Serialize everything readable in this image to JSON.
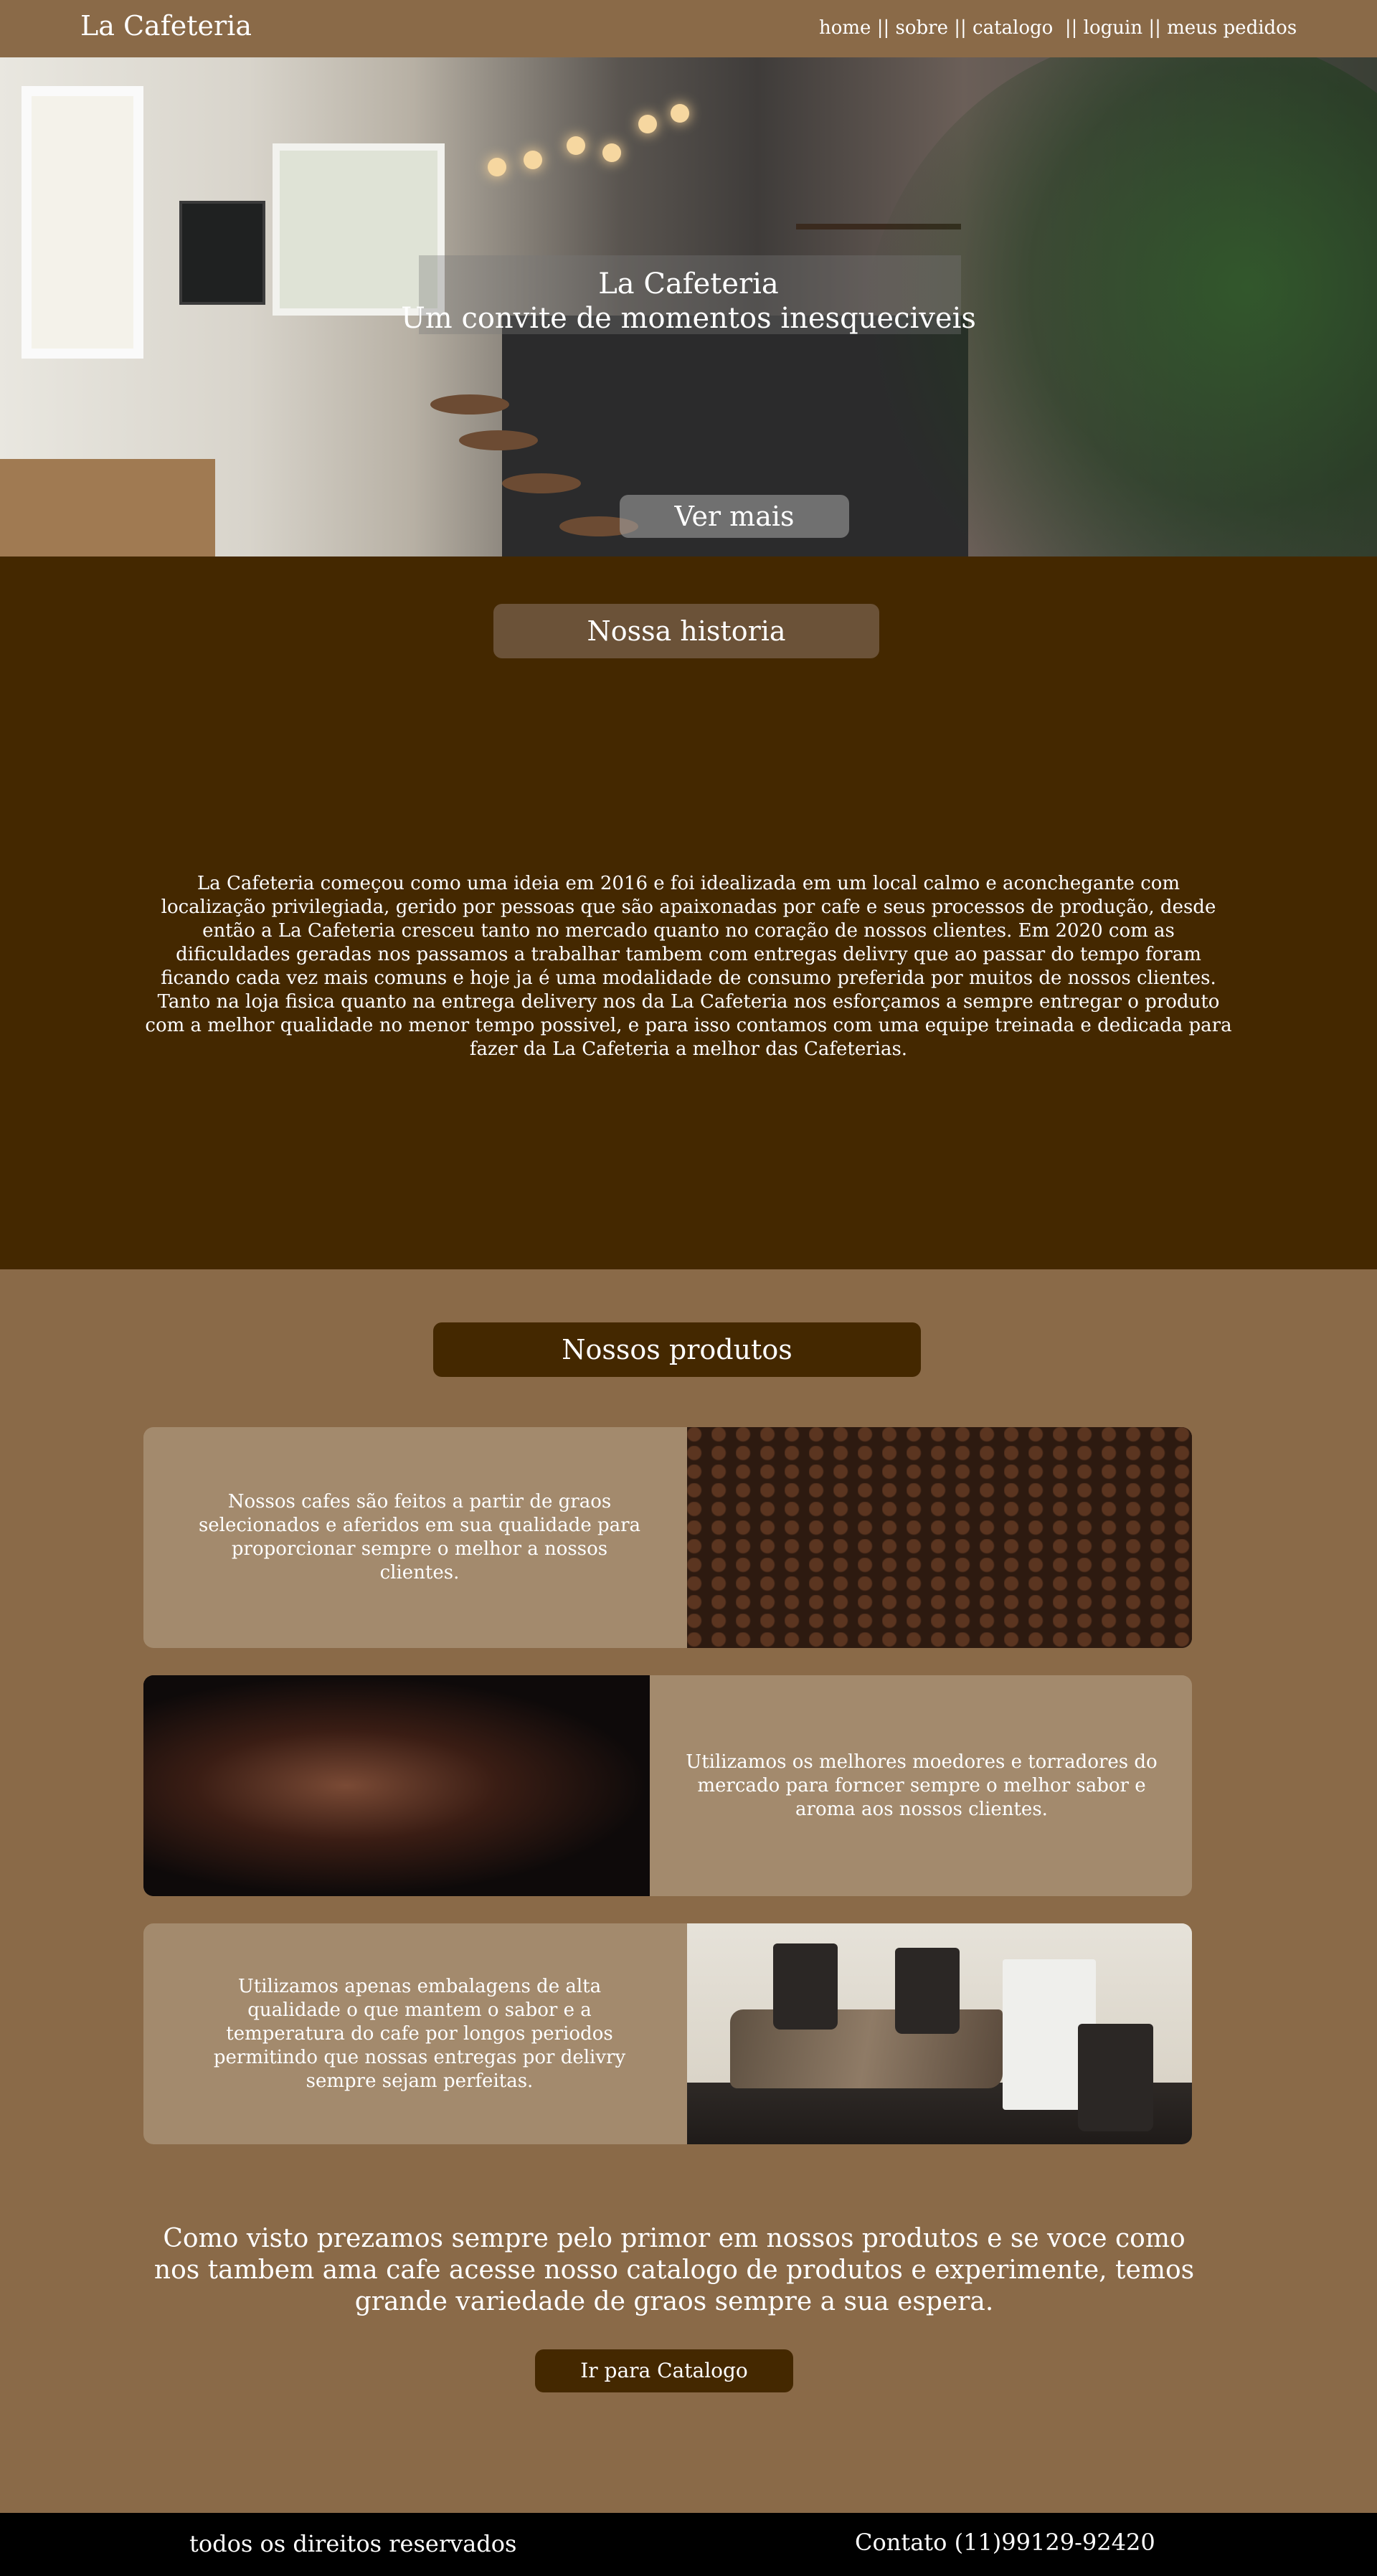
{
  "header": {
    "brand": "La Cafeteria",
    "nav": [
      {
        "label": "home"
      },
      {
        "label": "sobre"
      },
      {
        "label": "catalogo"
      },
      {
        "label": "loguin"
      },
      {
        "label": "meus pedidos"
      }
    ],
    "separator": "||"
  },
  "hero": {
    "title": "La Cafeteria",
    "subtitle": "Um convite de momentos inesqueciveis",
    "button_label": "Ver mais"
  },
  "history": {
    "heading": "Nossa historia",
    "text": "La Cafeteria começou como uma ideia em 2016 e foi idealizada em um local calmo e aconchegante com localização privilegiada, gerido por pessoas que são apaixonadas por cafe e seus processos de produção, desde então a La Cafeteria cresceu tanto no mercado quanto no coração de nossos clientes. Em 2020 com as dificuldades geradas nos passamos a trabalhar tambem com entregas delivry que ao passar do tempo foram ficando cada vez mais comuns e hoje ja é uma modalidade de consumo preferida por muitos de nossos clientes. Tanto na loja fisica quanto na entrega delivery nos da La Cafeteria nos esforçamos a sempre entregar o produto com a melhor qualidade no menor tempo possivel, e para isso contamos com uma equipe treinada e dedicada para fazer da La Cafeteria a melhor das Cafeterias."
  },
  "products": {
    "heading": "Nossos produtos",
    "cards": [
      {
        "text": "Nossos cafes são feitos a partir de graos selecionados e aferidos em sua qualidade para proporcionar sempre o melhor a nossos clientes."
      },
      {
        "text": "Utilizamos os melhores moedores e torradores do mercado para forncer sempre o melhor sabor e aroma aos nossos clientes."
      },
      {
        "text": "Utilizamos apenas embalagens de alta qualidade o que mantem o sabor e a temperatura do cafe por longos periodos permitindo que nossas entregas por delivry sempre sejam perfeitas."
      }
    ],
    "closing": "Como visto prezamos sempre pelo primor em nossos produtos e se voce como nos tambem ama cafe acesse nosso catalogo de produtos e experimente, temos grande variedade de graos sempre a sua espera.",
    "catalog_button": "Ir para Catalogo"
  },
  "footer": {
    "rights": "todos os direitos reservados",
    "contact": "Contato (11)99129-92420"
  },
  "colors": {
    "header_bg": "#8a6a48",
    "history_bg": "#442800",
    "card_bg": "#a38a6d",
    "footer_bg": "#000000"
  }
}
